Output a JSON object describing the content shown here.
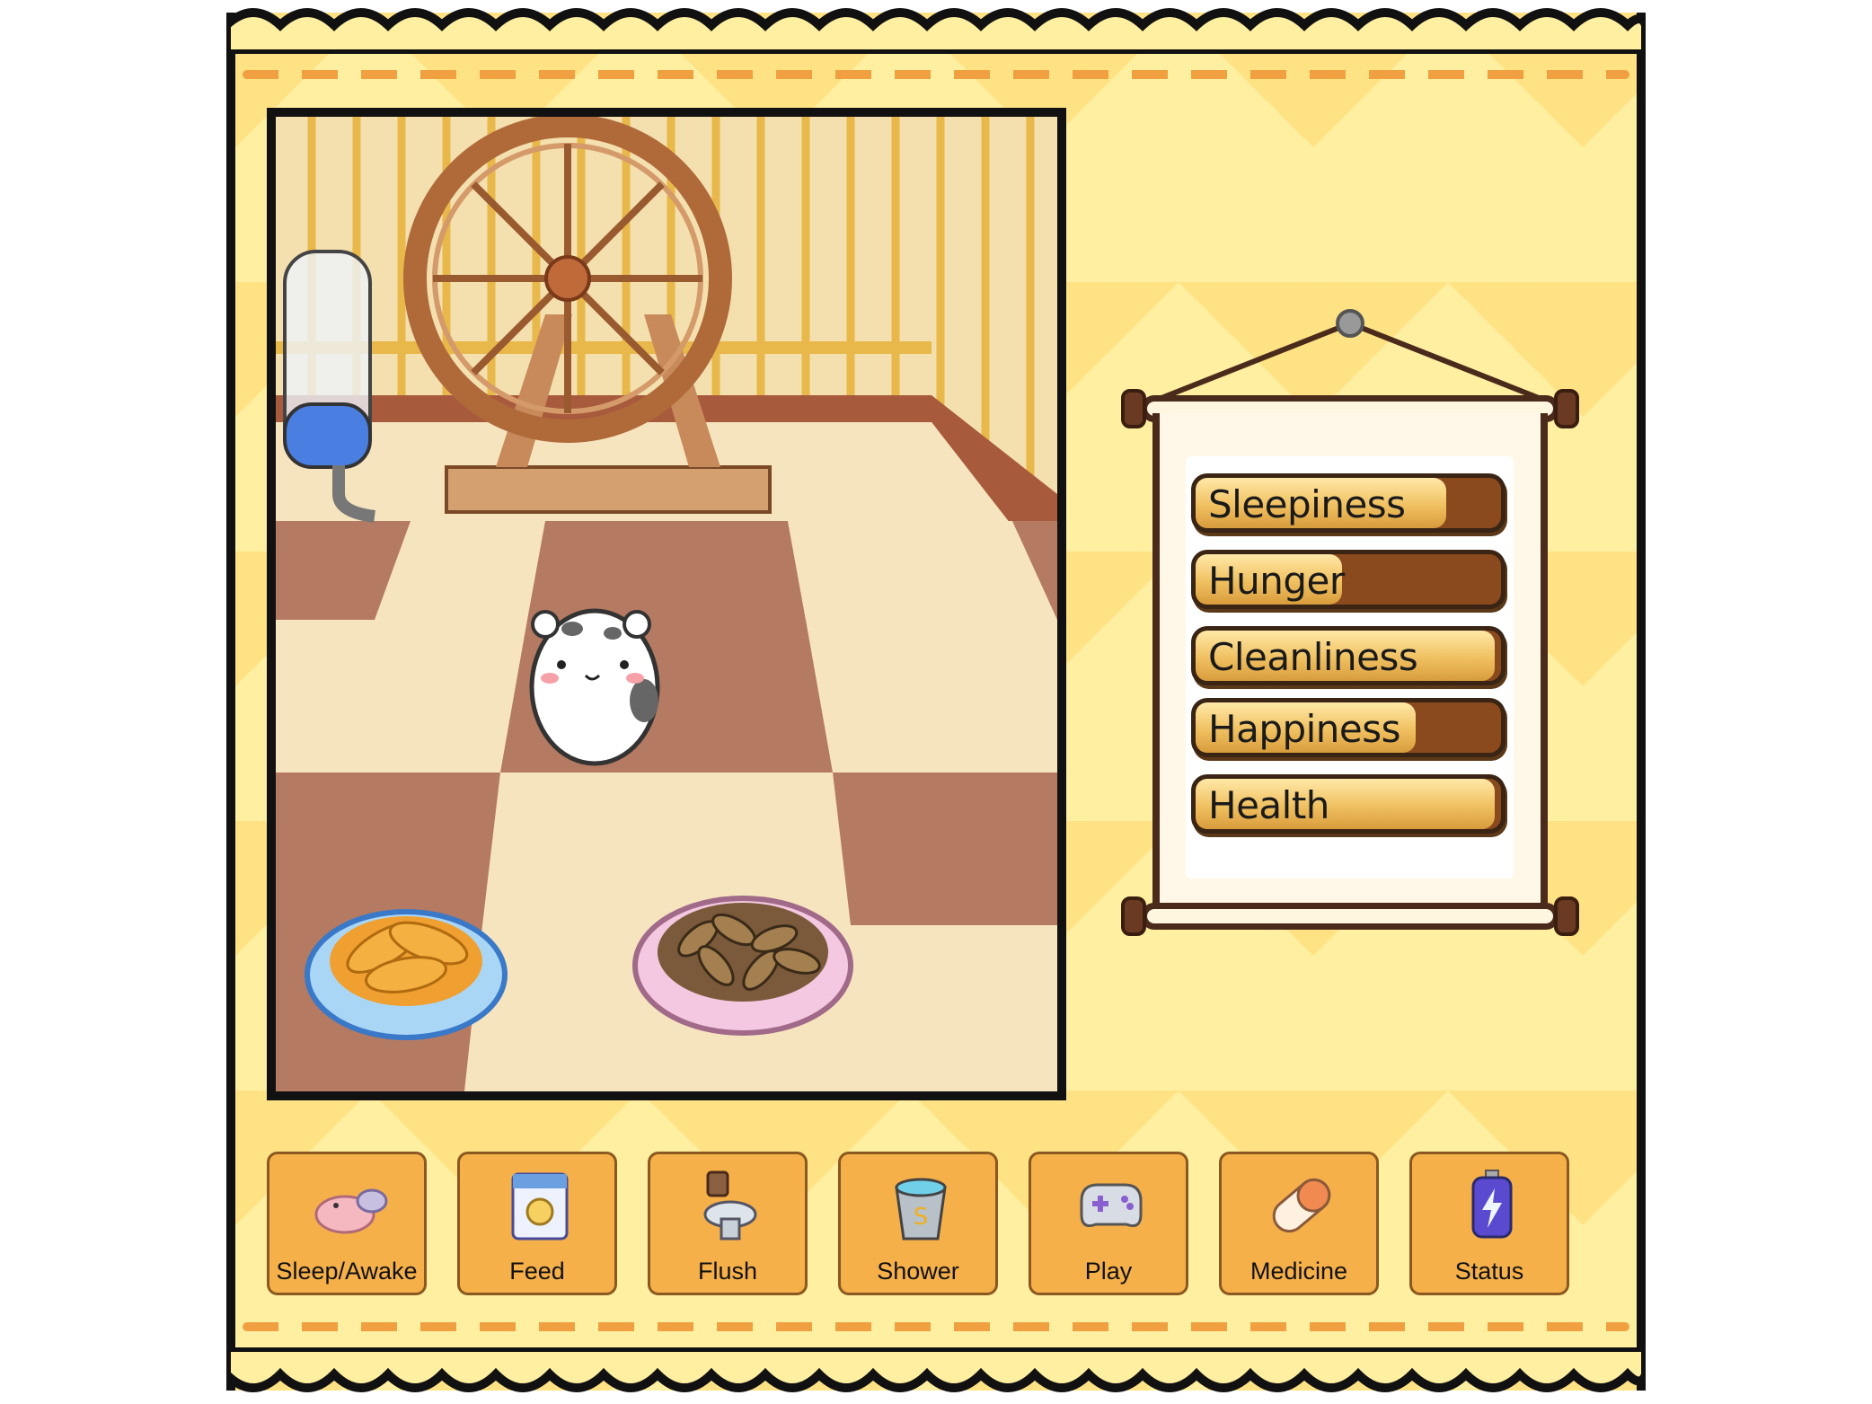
{
  "stats": [
    {
      "label": "Sleepiness",
      "level": 0.82
    },
    {
      "label": "Hunger",
      "level": 0.48
    },
    {
      "label": "Cleanliness",
      "level": 0.98
    },
    {
      "label": "Happiness",
      "level": 0.72
    },
    {
      "label": "Health",
      "level": 0.98
    }
  ],
  "actions": [
    {
      "label": "Sleep/Awake",
      "icon": "sleeping-hamster-icon"
    },
    {
      "label": "Feed",
      "icon": "food-bag-icon"
    },
    {
      "label": "Flush",
      "icon": "toilet-icon"
    },
    {
      "label": "Shower",
      "icon": "bucket-icon"
    },
    {
      "label": "Play",
      "icon": "gamepad-icon"
    },
    {
      "label": "Medicine",
      "icon": "pill-icon"
    },
    {
      "label": "Status",
      "icon": "battery-icon"
    }
  ],
  "colors": {
    "background": "#ffefa0",
    "stitch": "#f0a040",
    "button": "#f6b04a",
    "bar_empty": "#8b4a1e",
    "bar_full": "#f0c060"
  }
}
